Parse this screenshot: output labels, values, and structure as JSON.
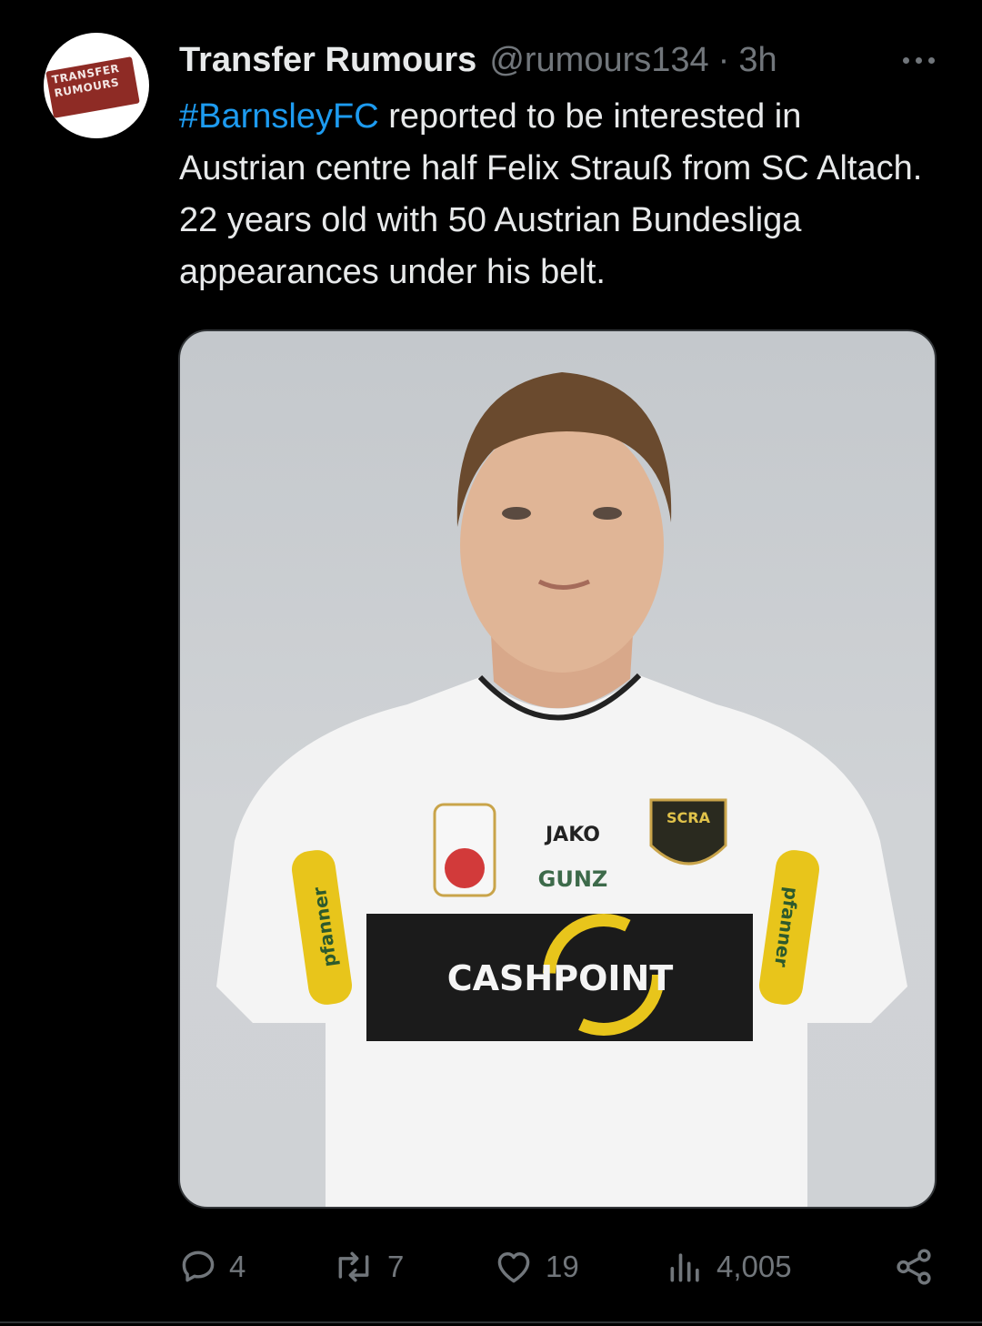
{
  "tweet": {
    "avatar": {
      "alt": "Transfer Rumours logo",
      "logo_text": "TRANSFER RUMOURS"
    },
    "author": {
      "name": "Transfer Rumours",
      "handle": "@rumours134",
      "separator": "·",
      "time": "3h"
    },
    "more_icon": "more-horizontal-icon",
    "text": {
      "hashtag": "#BarnsleyFC",
      "body": " reported to be interested in Austrian centre half Felix Strauß from SC Altach. 22 years old with 50 Austrian Bundesliga appearances under his belt."
    },
    "media": {
      "jersey_text": {
        "brand": "JAKO",
        "sponsor_small": "GUNZ",
        "club_crest": "SCRA",
        "main_sponsor": "CASHPOINT",
        "sleeve_sponsor": "pfanner"
      }
    },
    "actions": {
      "replies": {
        "icon": "reply-icon",
        "count": "4"
      },
      "reposts": {
        "icon": "repost-icon",
        "count": "7"
      },
      "likes": {
        "icon": "like-icon",
        "count": "19"
      },
      "views": {
        "icon": "views-icon",
        "count": "4,005"
      },
      "share": {
        "icon": "share-icon"
      }
    },
    "colors": {
      "background": "#000000",
      "text": "#e7e9ea",
      "secondary": "#71767b",
      "link": "#1d9bf0",
      "avatar_red": "#8e2b25"
    }
  }
}
